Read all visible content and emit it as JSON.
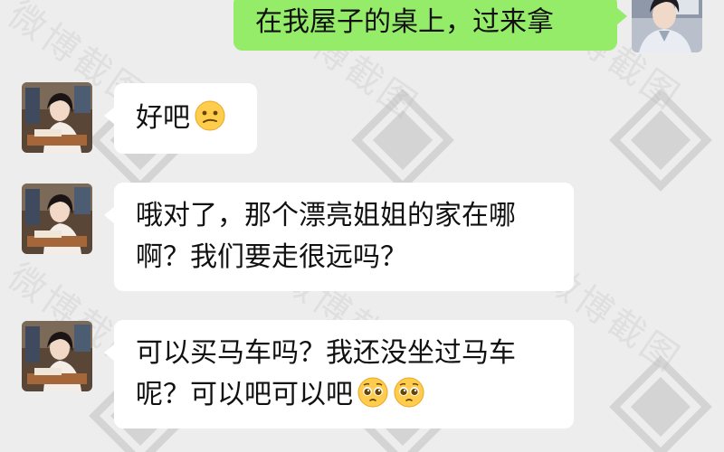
{
  "chat": {
    "messages": [
      {
        "sender": "me",
        "lines": [
          "在我屋子的桌上，过来拿"
        ]
      },
      {
        "sender": "other",
        "lines": [
          "好吧"
        ],
        "emojis": [
          "confused-face"
        ]
      },
      {
        "sender": "other",
        "lines": [
          "哦对了，那个漂亮姐姐的家在哪",
          "啊？我们要走很远吗？"
        ]
      },
      {
        "sender": "other",
        "lines": [
          "可以买马车吗？我还没坐过马车",
          "呢？可以吧可以吧"
        ],
        "emojis": [
          "pleading-face",
          "pleading-face"
        ]
      }
    ]
  },
  "watermark": {
    "text": "微博截图"
  },
  "colors": {
    "background": "#ededed",
    "outgoing_bubble": "#95ec69",
    "incoming_bubble": "#ffffff"
  }
}
